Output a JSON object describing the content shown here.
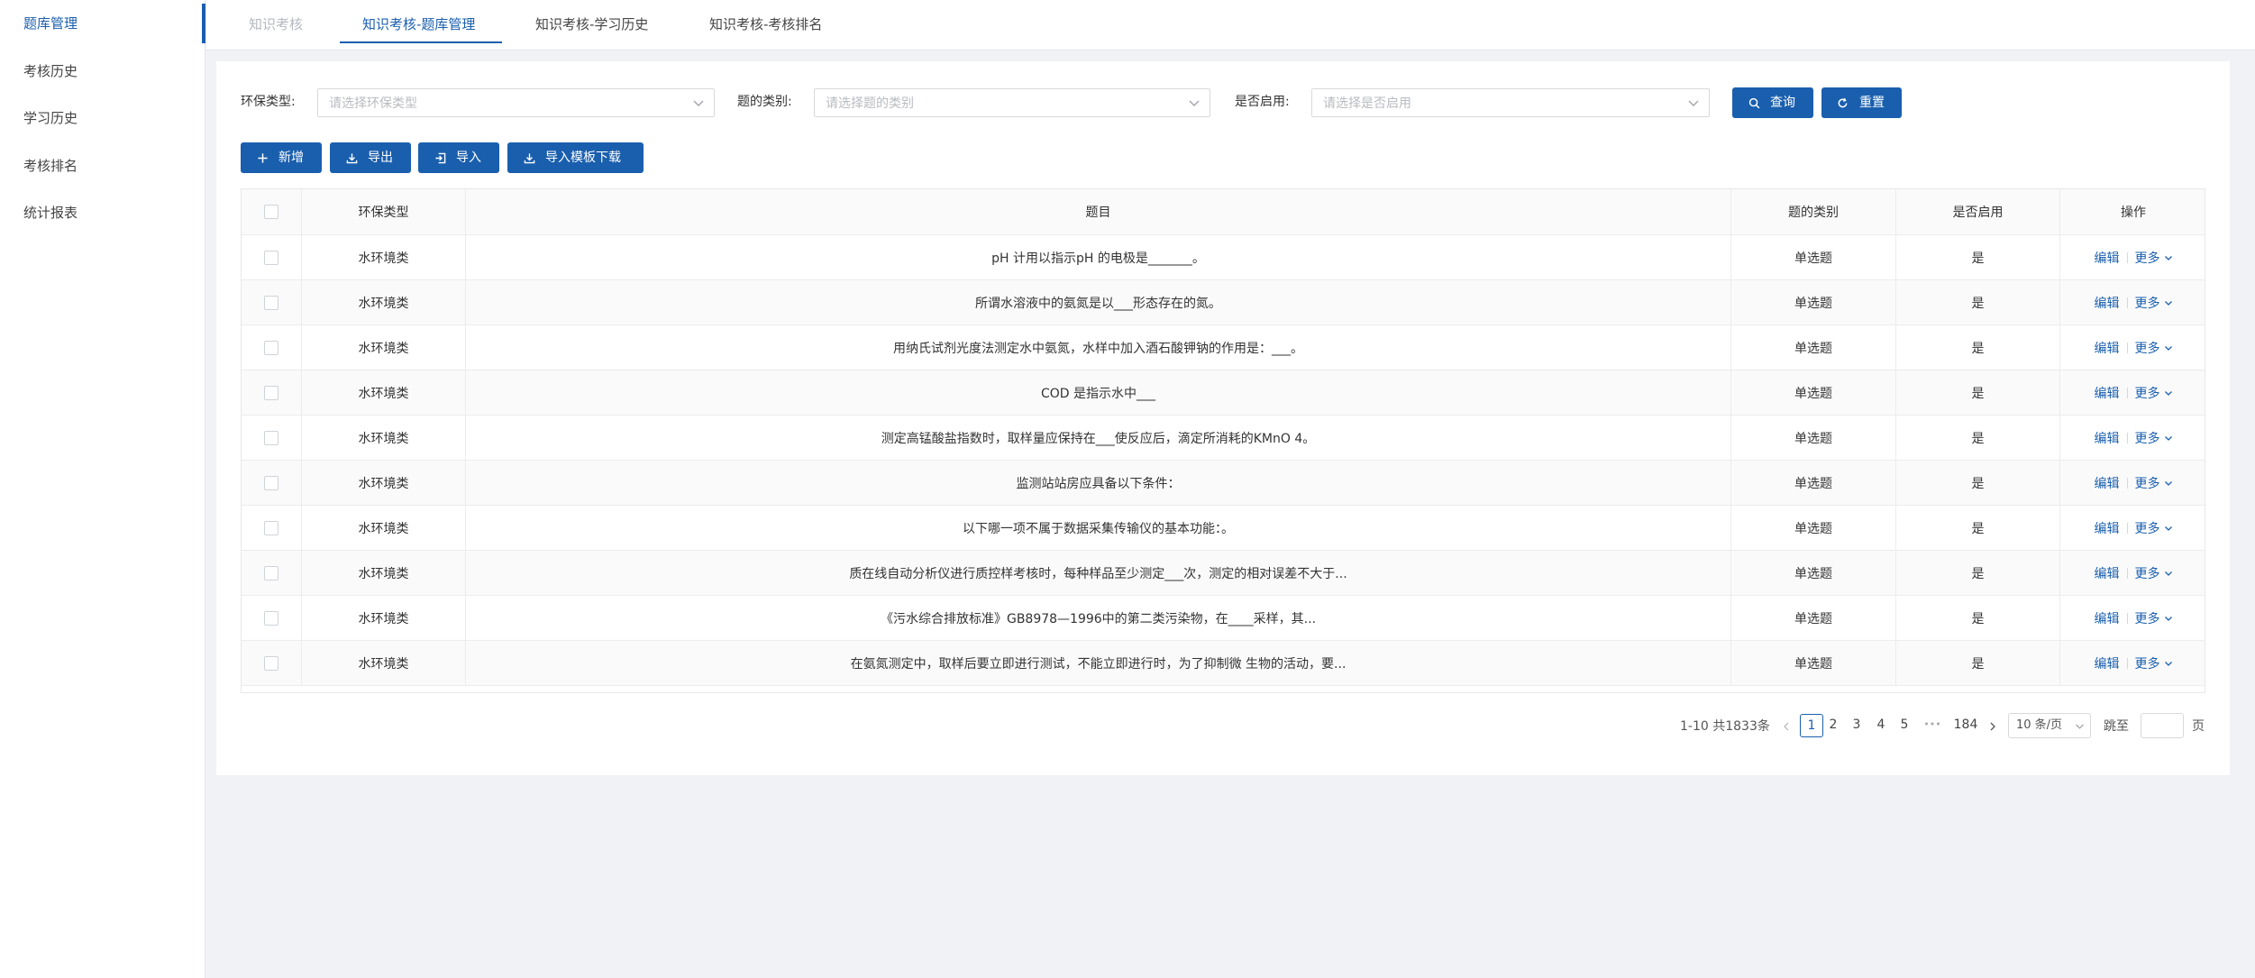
{
  "sidebar": {
    "items": [
      {
        "label": "题库管理",
        "active": true
      },
      {
        "label": "考核历史",
        "active": false
      },
      {
        "label": "学习历史",
        "active": false
      },
      {
        "label": "考核排名",
        "active": false
      },
      {
        "label": "统计报表",
        "active": false
      }
    ]
  },
  "tabs": [
    {
      "label": "知识考核",
      "state": "muted"
    },
    {
      "label": "知识考核-题库管理",
      "state": "active"
    },
    {
      "label": "知识考核-学习历史",
      "state": "normal"
    },
    {
      "label": "知识考核-考核排名",
      "state": "normal"
    }
  ],
  "filters": {
    "env_type": {
      "label": "环保类型:",
      "placeholder": "请选择环保类型"
    },
    "question_category": {
      "label": "题的类别:",
      "placeholder": "请选择题的类别"
    },
    "enabled": {
      "label": "是否启用:",
      "placeholder": "请选择是否启用"
    },
    "query_label": "查询",
    "reset_label": "重置"
  },
  "toolbar": {
    "add_label": "新增",
    "export_label": "导出",
    "import_label": "导入",
    "template_label": "导入模板下载"
  },
  "table": {
    "headers": {
      "env_type": "环保类型",
      "question": "题目",
      "category": "题的类别",
      "enabled": "是否启用",
      "actions": "操作"
    },
    "edit_label": "编辑",
    "more_label": "更多",
    "rows": [
      {
        "env_type": "水环境类",
        "question": "pH 计用以指示pH 的电极是_______。",
        "category": "单选题",
        "enabled": "是"
      },
      {
        "env_type": "水环境类",
        "question": "所谓水溶液中的氨氮是以___形态存在的氮。",
        "category": "单选题",
        "enabled": "是"
      },
      {
        "env_type": "水环境类",
        "question": "用纳氏试剂光度法测定水中氨氮，水样中加入酒石酸钾钠的作用是：___。",
        "category": "单选题",
        "enabled": "是"
      },
      {
        "env_type": "水环境类",
        "question": "COD 是指示水中___",
        "category": "单选题",
        "enabled": "是"
      },
      {
        "env_type": "水环境类",
        "question": "测定高锰酸盐指数时，取样量应保持在___使反应后，滴定所消耗的KMnO 4。",
        "category": "单选题",
        "enabled": "是"
      },
      {
        "env_type": "水环境类",
        "question": "监测站站房应具备以下条件：",
        "category": "单选题",
        "enabled": "是"
      },
      {
        "env_type": "水环境类",
        "question": "以下哪一项不属于数据采集传输仪的基本功能：。",
        "category": "单选题",
        "enabled": "是"
      },
      {
        "env_type": "水环境类",
        "question": "质在线自动分析仪进行质控样考核时，每种样品至少测定___次，测定的相对误差不大于...",
        "category": "单选题",
        "enabled": "是"
      },
      {
        "env_type": "水环境类",
        "question": "《污水综合排放标准》GB8978—1996中的第二类污染物，在____采样，其...",
        "category": "单选题",
        "enabled": "是"
      },
      {
        "env_type": "水环境类",
        "question": "在氨氮测定中，取样后要立即进行测试，不能立即进行时，为了抑制微 生物的活动，要...",
        "category": "单选题",
        "enabled": "是"
      }
    ]
  },
  "pagination": {
    "summary": "1-10 共1833条",
    "pages": [
      "1",
      "2",
      "3",
      "4",
      "5"
    ],
    "current": "1",
    "ellipsis": "•••",
    "last_page": "184",
    "page_size": "10 条/页",
    "jump_label": "跳至",
    "jump_suffix": "页"
  },
  "colors": {
    "primary": "#1a5fae",
    "stripe": "#fafafa",
    "border": "#ececec"
  }
}
